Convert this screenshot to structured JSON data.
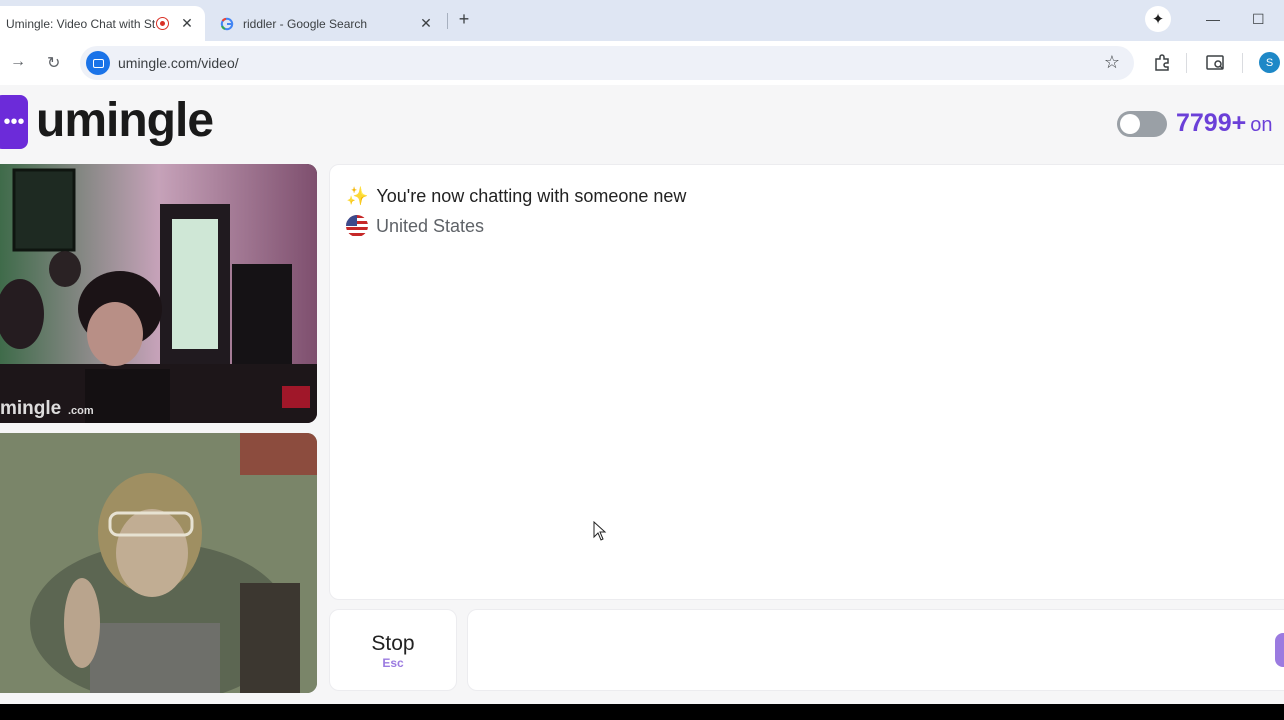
{
  "browser": {
    "tabs": [
      {
        "title": "Umingle: Video Chat with St",
        "active": true,
        "recording": true
      },
      {
        "title": "riddler - Google Search",
        "active": false
      }
    ],
    "url": "umingle.com/video/",
    "profile_initial": "S"
  },
  "site": {
    "logo": "umingle",
    "online_count": "7799+",
    "online_label": "on"
  },
  "videos": {
    "remote_watermark": "mingle",
    "remote_watermark_suffix": ".com"
  },
  "chat": {
    "status": "You're now chatting with someone new",
    "country": "United States"
  },
  "controls": {
    "stop_label": "Stop",
    "stop_key": "Esc"
  },
  "colors": {
    "brand": "#6c2bd9",
    "accent": "#6b40d8"
  }
}
